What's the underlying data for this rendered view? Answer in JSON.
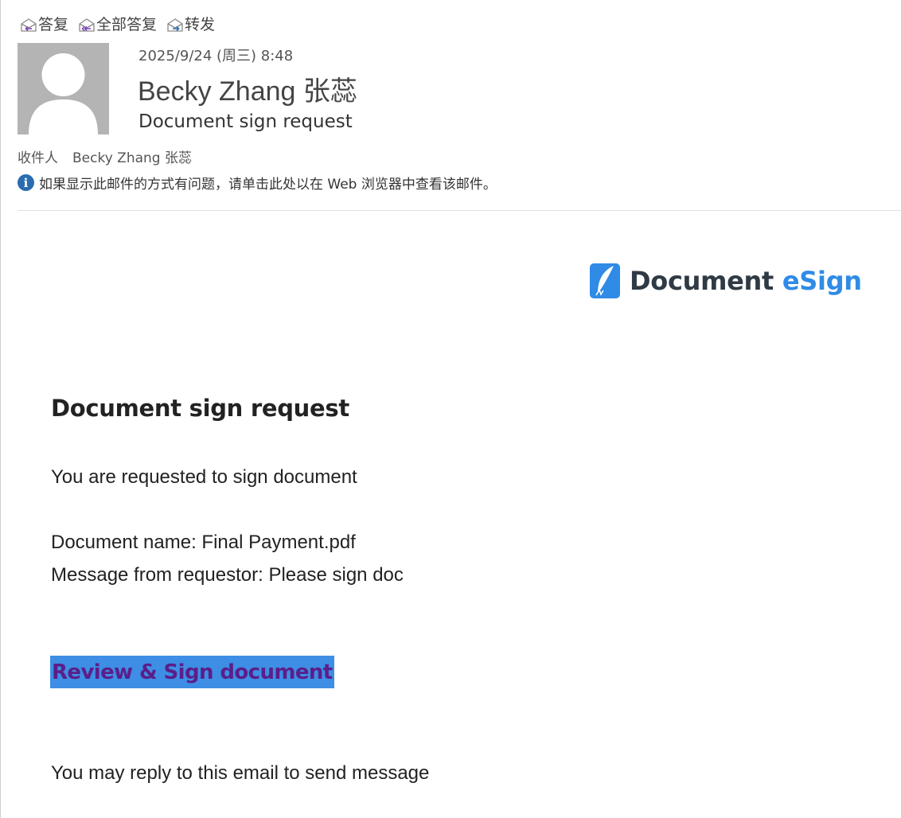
{
  "toolbar": {
    "reply_label": "答复",
    "reply_all_label": "全部答复",
    "forward_label": "转发"
  },
  "header": {
    "sent_date": "2025/9/24 (周三) 8:48",
    "sender_name": "Becky Zhang 张蕊",
    "subject": "Document sign request",
    "to_label": "收件人",
    "to_value": "Becky Zhang 张蕊",
    "info_text": "如果显示此邮件的方式有问题，请单击此处以在 Web 浏览器中查看该邮件。"
  },
  "body": {
    "logo_word1": "Document",
    "logo_word2": "eSign",
    "heading": "Document sign request",
    "line1": "You are requested to sign document",
    "document_name_line": "Document name: Final Payment.pdf",
    "message_line": "Message from requestor: Please sign doc",
    "sign_link_label": "Review & Sign document",
    "footer_line": "You may reply to this email to send message"
  },
  "icons": {
    "reply": "envelope-reply-icon",
    "reply_all": "envelope-reply-all-icon",
    "forward": "envelope-forward-icon",
    "info": "info-icon",
    "avatar": "person-silhouette",
    "logo": "feather-pen-logo"
  },
  "colors": {
    "logo_accent": "#2f8be6",
    "logo_dark": "#2f3a45",
    "link_highlight": "#3d8ee4",
    "link_text": "#5b1e8a",
    "info_icon": "#2b6cb0",
    "avatar_bg": "#b4b4b4"
  }
}
